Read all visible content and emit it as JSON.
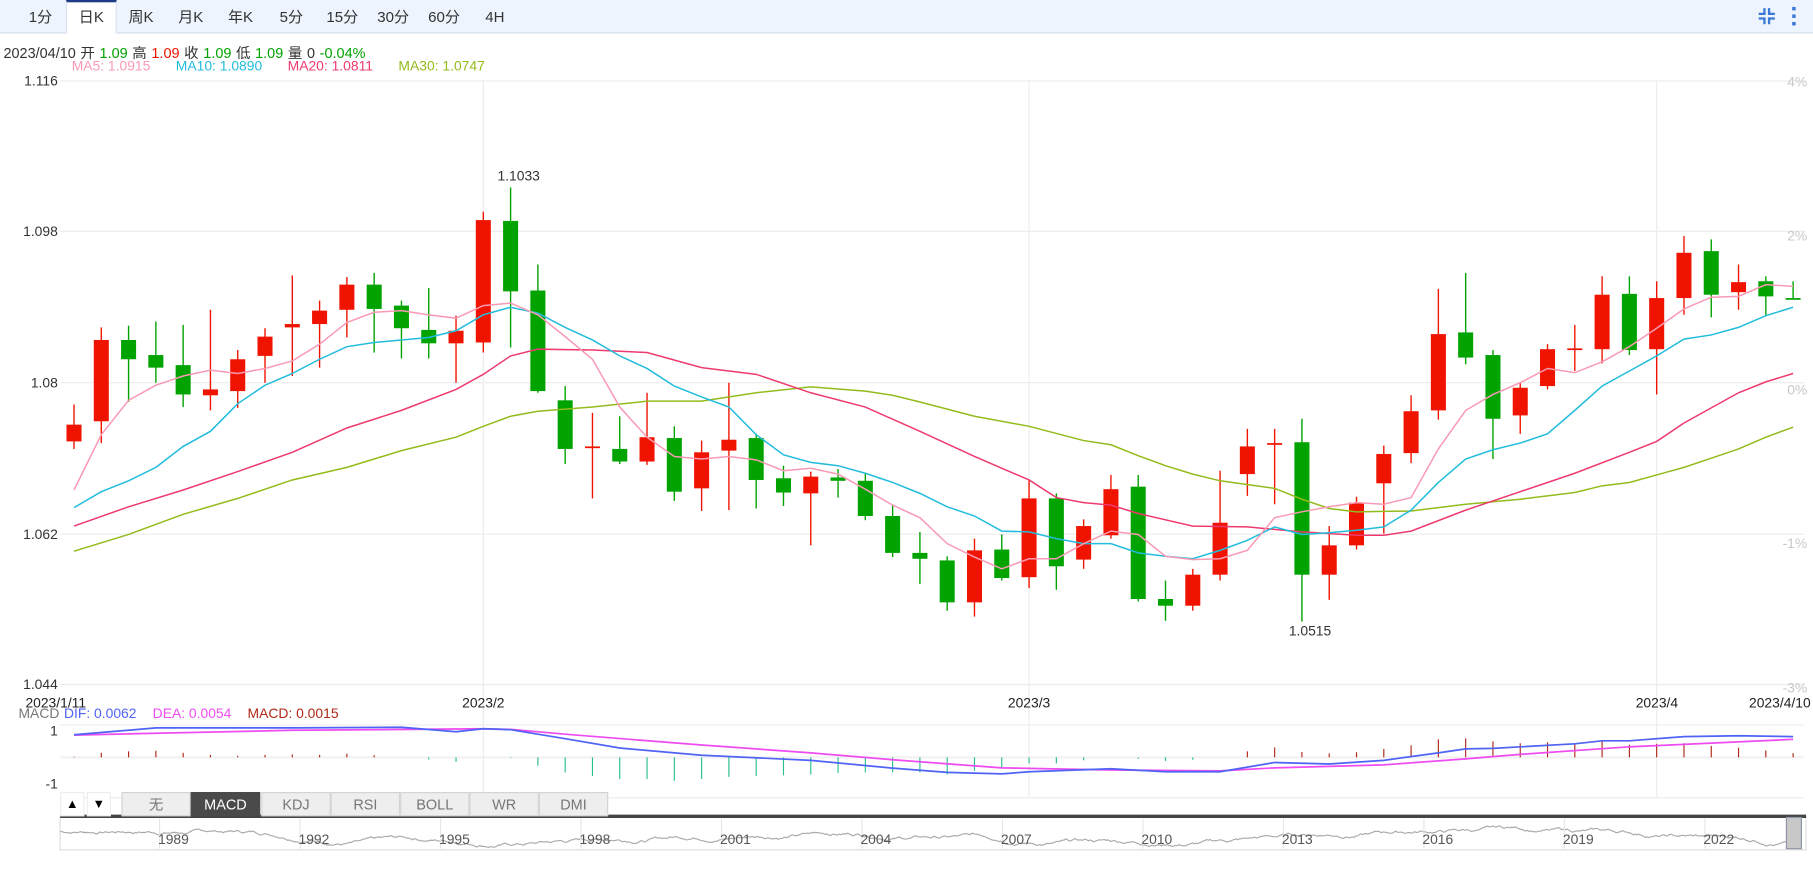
{
  "tabs": [
    "1分",
    "日K",
    "周K",
    "月K",
    "年K",
    "5分",
    "15分",
    "30分",
    "60分",
    "4H"
  ],
  "active_tab": "日K",
  "toolbar_icons": [
    "collapse-icon",
    "more-vertical-icon"
  ],
  "info": {
    "date": "2023/04/10",
    "open_label": "开",
    "open": "1.09",
    "high_label": "高",
    "high": "1.09",
    "close_label": "收",
    "close": "1.09",
    "low_label": "低",
    "low": "1.09",
    "volume_label": "量",
    "volume": "0",
    "change": "-0.04%"
  },
  "ma_legend": {
    "ma5": "MA5: 1.0915",
    "ma10": "MA10: 1.0890",
    "ma20": "MA20: 1.0811",
    "ma30": "MA30: 1.0747"
  },
  "colors": {
    "up": "#f01400",
    "down": "#00a300",
    "ma5": "#f99ab5",
    "ma10": "#22bcdc",
    "ma20": "#ee3a6e",
    "ma30": "#93bb1c",
    "dif": "#4f63f5",
    "dea": "#ee4cf0",
    "macd": "#b02818",
    "hist_down": "#29c08a"
  },
  "chart_data": {
    "type": "candlestick",
    "y_ticks": [
      "1.116",
      "1.098",
      "1.08",
      "1.062",
      "1.044"
    ],
    "y_range": [
      1.044,
      1.116
    ],
    "right_ticks": [
      "4%",
      "2%",
      "0%",
      "-1%",
      "-3%"
    ],
    "x_labels": [
      {
        "text": "2023/1/11",
        "index": 0
      },
      {
        "text": "2023/2",
        "index": 15
      },
      {
        "text": "2023/3",
        "index": 35
      },
      {
        "text": "2023/4",
        "index": 58
      },
      {
        "text": "2023/4/10",
        "index": 63
      }
    ],
    "high_annotation": {
      "text": "1.1033",
      "index": 16
    },
    "low_annotation": {
      "text": "1.0515",
      "index": 45
    },
    "candles_ohlc": [
      [
        1.073,
        1.0774,
        1.0721,
        1.075
      ],
      [
        1.0754,
        1.0866,
        1.0728,
        1.0851
      ],
      [
        1.0851,
        1.0868,
        1.0777,
        1.0828
      ],
      [
        1.0833,
        1.0873,
        1.08,
        1.0818
      ],
      [
        1.0821,
        1.0869,
        1.0771,
        1.0786
      ],
      [
        1.0785,
        1.0887,
        1.0767,
        1.0792
      ],
      [
        1.079,
        1.0839,
        1.077,
        1.0828
      ],
      [
        1.0832,
        1.0865,
        1.08,
        1.0855
      ],
      [
        1.0866,
        1.0928,
        1.0808,
        1.087
      ],
      [
        1.087,
        1.0898,
        1.0818,
        1.0886
      ],
      [
        1.0887,
        1.0926,
        1.0854,
        1.0917
      ],
      [
        1.0917,
        1.0931,
        1.0836,
        1.0888
      ],
      [
        1.0892,
        1.0898,
        1.0829,
        1.0865
      ],
      [
        1.0863,
        1.0913,
        1.0829,
        1.0847
      ],
      [
        1.0847,
        1.088,
        1.08,
        1.0862
      ],
      [
        1.0848,
        1.1004,
        1.0836,
        1.0994
      ],
      [
        1.0993,
        1.1033,
        1.0842,
        1.0909
      ],
      [
        1.091,
        1.0941,
        1.0788,
        1.079
      ],
      [
        1.0779,
        1.0796,
        1.0703,
        1.0721
      ],
      [
        1.0722,
        1.0764,
        1.0662,
        1.0724
      ],
      [
        1.0721,
        1.076,
        1.0703,
        1.0706
      ],
      [
        1.0706,
        1.0788,
        1.0702,
        1.0735
      ],
      [
        1.0734,
        1.0748,
        1.0659,
        1.067
      ],
      [
        1.0674,
        1.0731,
        1.0647,
        1.0717
      ],
      [
        1.0719,
        1.08,
        1.0648,
        1.0732
      ],
      [
        1.0734,
        1.0739,
        1.065,
        1.0684
      ],
      [
        1.0686,
        1.0701,
        1.0653,
        1.0669
      ],
      [
        1.0668,
        1.0694,
        1.0606,
        1.0688
      ],
      [
        1.0687,
        1.0697,
        1.0663,
        1.0683
      ],
      [
        1.0683,
        1.0692,
        1.0636,
        1.0641
      ],
      [
        1.0641,
        1.0654,
        1.0592,
        1.0597
      ],
      [
        1.0597,
        1.0622,
        1.056,
        1.059
      ],
      [
        1.0588,
        1.0593,
        1.0528,
        1.0538
      ],
      [
        1.0538,
        1.0614,
        1.0521,
        1.06
      ],
      [
        1.0601,
        1.0619,
        1.0564,
        1.0567
      ],
      [
        1.0568,
        1.0684,
        1.0555,
        1.0662
      ],
      [
        1.0662,
        1.0668,
        1.0553,
        1.0581
      ],
      [
        1.0589,
        1.0637,
        1.0578,
        1.0629
      ],
      [
        1.0618,
        1.069,
        1.0614,
        1.0673
      ],
      [
        1.0676,
        1.069,
        1.0539,
        1.0542
      ],
      [
        1.0542,
        1.0564,
        1.0516,
        1.0534
      ],
      [
        1.0534,
        1.0578,
        1.0528,
        1.0571
      ],
      [
        1.0571,
        1.0695,
        1.0564,
        1.0633
      ],
      [
        1.0691,
        1.0745,
        1.0665,
        1.0724
      ],
      [
        1.0726,
        1.0745,
        1.0655,
        1.0728
      ],
      [
        1.0729,
        1.0757,
        1.0515,
        1.0571
      ],
      [
        1.0571,
        1.0629,
        1.0541,
        1.0606
      ],
      [
        1.0606,
        1.0664,
        1.0601,
        1.0657
      ],
      [
        1.068,
        1.0725,
        1.062,
        1.0715
      ],
      [
        1.0716,
        1.0785,
        1.0704,
        1.0766
      ],
      [
        1.0767,
        1.0912,
        1.0756,
        1.0858
      ],
      [
        1.086,
        1.0931,
        1.0822,
        1.083
      ],
      [
        1.0833,
        1.0839,
        1.0709,
        1.0757
      ],
      [
        1.0761,
        1.08,
        1.0739,
        1.0794
      ],
      [
        1.0796,
        1.0846,
        1.0792,
        1.084
      ],
      [
        1.084,
        1.0869,
        1.0814,
        1.0841
      ],
      [
        1.084,
        1.0927,
        1.0823,
        1.0905
      ],
      [
        1.0906,
        1.0927,
        1.0833,
        1.0839
      ],
      [
        1.084,
        1.0921,
        1.0786,
        1.0901
      ],
      [
        1.0901,
        1.0975,
        1.0881,
        1.0955
      ],
      [
        1.0957,
        1.0971,
        1.0878,
        1.0905
      ],
      [
        1.0908,
        1.0941,
        1.0887,
        1.092
      ],
      [
        1.0921,
        1.0927,
        1.088,
        1.0903
      ],
      [
        1.0901,
        1.0921,
        1.09,
        1.09
      ]
    ],
    "ma5": [
      1.0672,
      1.0738,
      1.0779,
      1.0797,
      1.0808,
      1.0815,
      1.0811,
      1.0817,
      1.0826,
      1.0846,
      1.0872,
      1.0884,
      1.0886,
      1.0881,
      1.0877,
      1.0892,
      1.0895,
      1.0881,
      1.0855,
      1.0828,
      1.0771,
      1.0735,
      1.0712,
      1.0709,
      1.0712,
      1.0708,
      1.0695,
      1.0698,
      1.0691,
      1.0673,
      1.0654,
      1.0639,
      1.0608,
      1.0592,
      1.0578,
      1.059,
      1.059,
      1.0608,
      1.0623,
      1.0619,
      1.0593,
      1.0589,
      1.059,
      1.06,
      1.0639,
      1.0646,
      1.0652,
      1.0657,
      1.0655,
      1.0663,
      1.0721,
      1.0767,
      1.0786,
      1.08,
      1.0817,
      1.0812,
      1.0825,
      1.0843,
      1.0865,
      1.0888,
      1.0902,
      1.0903,
      1.0917,
      1.0915
    ],
    "ma10": [
      1.0651,
      1.067,
      1.0683,
      1.0699,
      1.0724,
      1.0742,
      1.0775,
      1.0797,
      1.0811,
      1.0828,
      1.0843,
      1.0848,
      1.0851,
      1.0854,
      1.0862,
      1.0881,
      1.089,
      1.0883,
      1.0866,
      1.0851,
      1.0832,
      1.0817,
      1.0796,
      1.0783,
      1.0771,
      1.0738,
      1.0714,
      1.0705,
      1.0701,
      1.0692,
      1.0681,
      1.0668,
      1.0652,
      1.0641,
      1.0623,
      1.0622,
      1.0614,
      1.0608,
      1.0608,
      1.0597,
      1.0593,
      1.059,
      1.06,
      1.0612,
      1.0628,
      1.0619,
      1.0621,
      1.0624,
      1.0628,
      1.0648,
      1.0681,
      1.0709,
      1.072,
      1.0728,
      1.0739,
      1.0767,
      1.0796,
      1.0814,
      1.0832,
      1.0852,
      1.0857,
      1.0866,
      1.088,
      1.089
    ],
    "ma20_points": [
      [
        0,
        1.0629
      ],
      [
        2,
        1.0652
      ],
      [
        4,
        1.0672
      ],
      [
        6,
        1.0694
      ],
      [
        8,
        1.0717
      ],
      [
        10,
        1.0746
      ],
      [
        12,
        1.0767
      ],
      [
        14,
        1.0792
      ],
      [
        15,
        1.081
      ],
      [
        16,
        1.0832
      ],
      [
        17,
        1.084
      ],
      [
        19,
        1.0839
      ],
      [
        21,
        1.0836
      ],
      [
        23,
        1.0818
      ],
      [
        25,
        1.081
      ],
      [
        27,
        1.0788
      ],
      [
        29,
        1.0771
      ],
      [
        31,
        1.0742
      ],
      [
        33,
        1.0712
      ],
      [
        35,
        1.0684
      ],
      [
        36,
        1.0663
      ],
      [
        37,
        1.0657
      ],
      [
        38,
        1.0654
      ],
      [
        39,
        1.0644
      ],
      [
        41,
        1.0629
      ],
      [
        43,
        1.0628
      ],
      [
        45,
        1.0622
      ],
      [
        47,
        1.0618
      ],
      [
        48,
        1.0618
      ],
      [
        49,
        1.0623
      ],
      [
        51,
        1.0648
      ],
      [
        53,
        1.067
      ],
      [
        55,
        1.0692
      ],
      [
        57,
        1.0717
      ],
      [
        58,
        1.073
      ],
      [
        59,
        1.0752
      ],
      [
        60,
        1.077
      ],
      [
        61,
        1.0788
      ],
      [
        62,
        1.0801
      ],
      [
        63,
        1.0811
      ]
    ],
    "ma30_points": [
      [
        0,
        1.0599
      ],
      [
        2,
        1.0619
      ],
      [
        4,
        1.0643
      ],
      [
        6,
        1.0662
      ],
      [
        8,
        1.0684
      ],
      [
        10,
        1.0699
      ],
      [
        12,
        1.0719
      ],
      [
        14,
        1.0735
      ],
      [
        15,
        1.0748
      ],
      [
        16,
        1.076
      ],
      [
        17,
        1.0766
      ],
      [
        19,
        1.0771
      ],
      [
        21,
        1.0778
      ],
      [
        23,
        1.0778
      ],
      [
        25,
        1.0788
      ],
      [
        27,
        1.0795
      ],
      [
        29,
        1.079
      ],
      [
        30,
        1.0785
      ],
      [
        31,
        1.0777
      ],
      [
        33,
        1.076
      ],
      [
        35,
        1.0748
      ],
      [
        37,
        1.0731
      ],
      [
        38,
        1.0726
      ],
      [
        39,
        1.0713
      ],
      [
        40,
        1.0701
      ],
      [
        41,
        1.0691
      ],
      [
        42,
        1.0683
      ],
      [
        44,
        1.0674
      ],
      [
        45,
        1.0661
      ],
      [
        46,
        1.065
      ],
      [
        47,
        1.0646
      ],
      [
        49,
        1.0647
      ],
      [
        51,
        1.0655
      ],
      [
        53,
        1.0661
      ],
      [
        55,
        1.0669
      ],
      [
        56,
        1.0677
      ],
      [
        57,
        1.0681
      ],
      [
        58,
        1.069
      ],
      [
        59,
        1.0699
      ],
      [
        60,
        1.071
      ],
      [
        61,
        1.0721
      ],
      [
        62,
        1.0735
      ],
      [
        63,
        1.0747
      ]
    ]
  },
  "macd": {
    "label": "MACD",
    "dif_label": "DIF: 0.0062",
    "dea_label": "DEA: 0.0054",
    "macd_label": "MACD: 0.0015",
    "y_ticks": [
      "1",
      "-1"
    ],
    "dif_points": [
      [
        0,
        0.75
      ],
      [
        3,
        0.98
      ],
      [
        8,
        0.98
      ],
      [
        12,
        1.0
      ],
      [
        14,
        0.85
      ],
      [
        15,
        0.95
      ],
      [
        16,
        0.92
      ],
      [
        18,
        0.62
      ],
      [
        20,
        0.31
      ],
      [
        23,
        0.07
      ],
      [
        27,
        -0.1
      ],
      [
        30,
        -0.36
      ],
      [
        32,
        -0.5
      ],
      [
        34,
        -0.55
      ],
      [
        35,
        -0.48
      ],
      [
        38,
        -0.38
      ],
      [
        40,
        -0.48
      ],
      [
        42,
        -0.48
      ],
      [
        44,
        -0.17
      ],
      [
        46,
        -0.22
      ],
      [
        48,
        -0.1
      ],
      [
        50,
        0.15
      ],
      [
        51,
        0.28
      ],
      [
        52,
        0.3
      ],
      [
        55,
        0.45
      ],
      [
        56,
        0.55
      ],
      [
        57,
        0.55
      ],
      [
        59,
        0.69
      ],
      [
        61,
        0.72
      ],
      [
        63,
        0.69
      ]
    ],
    "dea_points": [
      [
        0,
        0.74
      ],
      [
        8,
        0.9
      ],
      [
        15,
        0.95
      ],
      [
        16,
        0.93
      ],
      [
        18,
        0.77
      ],
      [
        23,
        0.41
      ],
      [
        27,
        0.15
      ],
      [
        30,
        -0.08
      ],
      [
        34,
        -0.35
      ],
      [
        38,
        -0.42
      ],
      [
        42,
        -0.45
      ],
      [
        44,
        -0.35
      ],
      [
        48,
        -0.25
      ],
      [
        51,
        -0.05
      ],
      [
        53,
        0.1
      ],
      [
        57,
        0.35
      ],
      [
        63,
        0.6
      ]
    ],
    "hist": [
      0.02,
      0.15,
      0.2,
      0.22,
      0.15,
      0.08,
      0.05,
      0.08,
      0.1,
      0.08,
      0.12,
      0.07,
      0,
      -0.07,
      -0.15,
      0,
      -0.02,
      -0.28,
      -0.5,
      -0.62,
      -0.72,
      -0.72,
      -0.78,
      -0.72,
      -0.65,
      -0.62,
      -0.6,
      -0.57,
      -0.52,
      -0.5,
      -0.5,
      -0.5,
      -0.57,
      -0.45,
      -0.35,
      -0.2,
      -0.2,
      -0.1,
      0,
      -0.05,
      -0.12,
      -0.08,
      0,
      0.2,
      0.33,
      0.18,
      0.13,
      0.17,
      0.28,
      0.4,
      0.6,
      0.63,
      0.53,
      0.47,
      0.5,
      0.46,
      0.53,
      0.42,
      0.45,
      0.47,
      0.38,
      0.32,
      0.23,
      0.14
    ]
  },
  "indicator_tabs": [
    "无",
    "MACD",
    "KDJ",
    "RSI",
    "BOLL",
    "WR",
    "DMI"
  ],
  "active_indicator": "MACD",
  "arrows": {
    "up": "▲",
    "down": "▼"
  },
  "navigator_years": [
    "1989",
    "1992",
    "1995",
    "1998",
    "2001",
    "2004",
    "2007",
    "2010",
    "2013",
    "2016",
    "2019",
    "2022"
  ]
}
